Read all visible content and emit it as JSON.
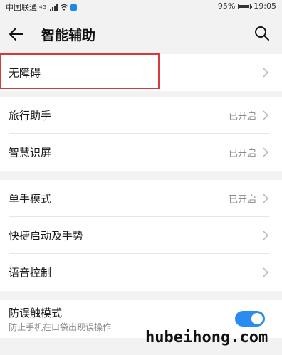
{
  "status_bar": {
    "carrier": "中国联通",
    "network_tag": "4G",
    "battery_text": "95%",
    "battery_level": 0.95,
    "time": "19:05"
  },
  "header": {
    "title": "智能辅助",
    "back_icon": "arrow-left-icon",
    "search_icon": "search-icon"
  },
  "groups": [
    {
      "items": [
        {
          "label": "无障碍",
          "status": ""
        }
      ]
    },
    {
      "items": [
        {
          "label": "旅行助手",
          "status": "已开启"
        },
        {
          "label": "智慧识屏",
          "status": "已开启"
        }
      ]
    },
    {
      "items": [
        {
          "label": "单手模式",
          "status": "已开启"
        },
        {
          "label": "快捷启动及手势",
          "status": ""
        },
        {
          "label": "语音控制",
          "status": ""
        }
      ]
    }
  ],
  "anti_mistouch": {
    "label": "防误触模式",
    "description": "防止手机在口袋出现误操作",
    "enabled": true
  },
  "watermark": "hubeihong.com",
  "colors": {
    "highlight": "#d83a3a",
    "toggle_on": "#2a8cf0",
    "status_text": "#8a8a8a"
  }
}
